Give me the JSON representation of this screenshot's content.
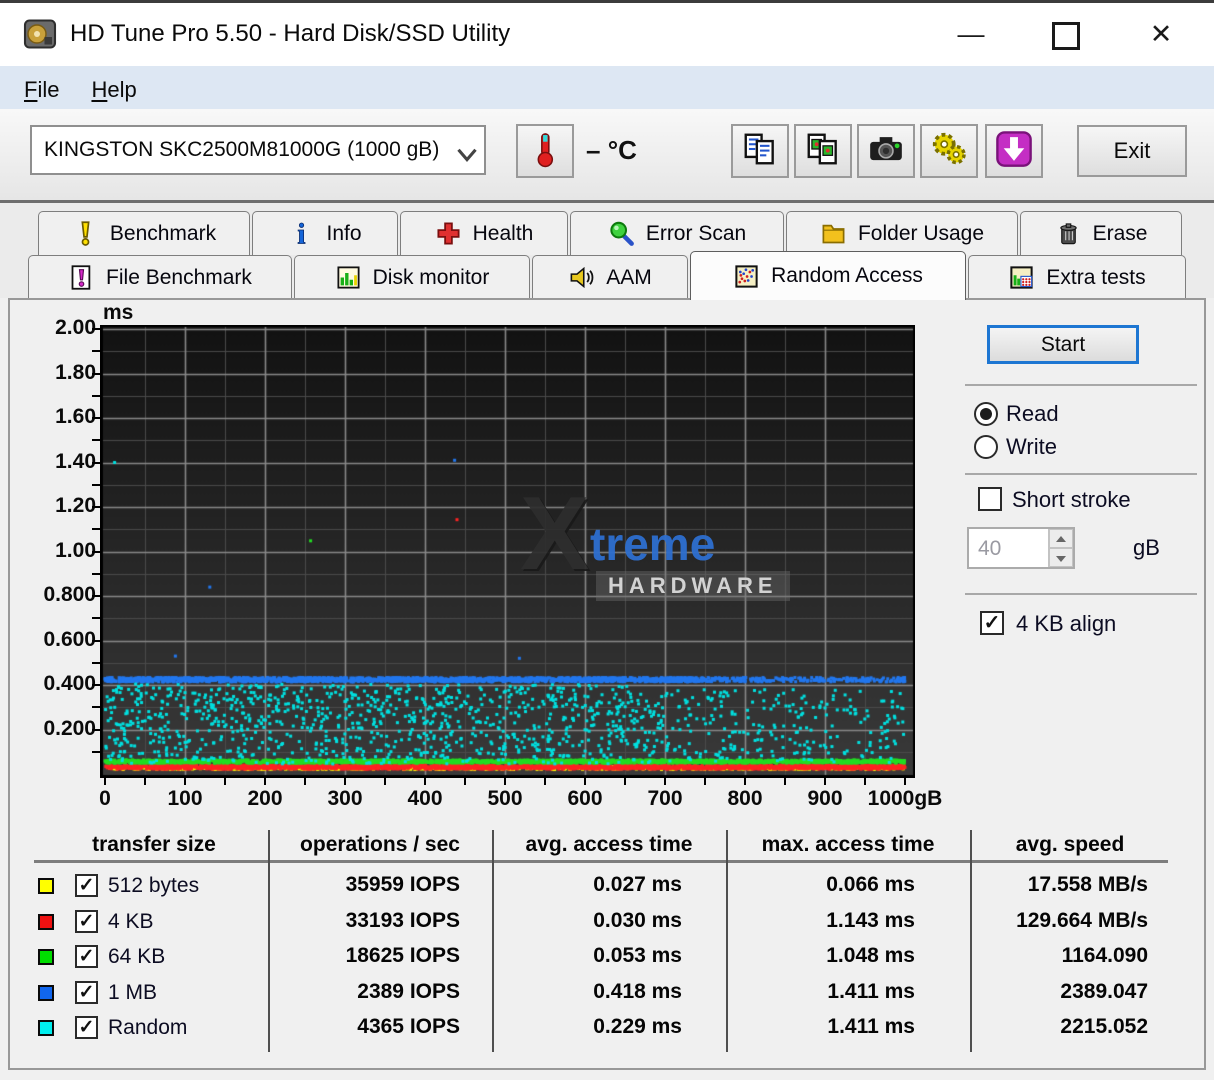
{
  "window": {
    "title": "HD Tune Pro 5.50 - Hard Disk/SSD Utility"
  },
  "menu": {
    "items": [
      {
        "label": "File"
      },
      {
        "label": "Help"
      }
    ]
  },
  "toolbar": {
    "device_select": {
      "value": "KINGSTON SKC2500M81000G (1000 gB)"
    },
    "temperature": {
      "value": "–",
      "unit": "°C"
    },
    "buttons": [
      {
        "name": "copy-text-button",
        "icon": "copy-text-icon"
      },
      {
        "name": "copy-image-button",
        "icon": "copy-image-icon"
      },
      {
        "name": "screenshot-button",
        "icon": "camera-icon"
      },
      {
        "name": "options-button",
        "icon": "gears-icon"
      },
      {
        "name": "update-button",
        "icon": "download-icon"
      }
    ],
    "exit_label": "Exit"
  },
  "tabs": {
    "row1": [
      {
        "label": "Benchmark",
        "icon": "benchmark-icon"
      },
      {
        "label": "Info",
        "icon": "info-icon"
      },
      {
        "label": "Health",
        "icon": "health-icon"
      },
      {
        "label": "Error Scan",
        "icon": "error-scan-icon"
      },
      {
        "label": "Folder Usage",
        "icon": "folder-icon"
      },
      {
        "label": "Erase",
        "icon": "erase-icon"
      }
    ],
    "row2": [
      {
        "label": "File Benchmark",
        "icon": "file-benchmark-icon"
      },
      {
        "label": "Disk monitor",
        "icon": "disk-monitor-icon"
      },
      {
        "label": "AAM",
        "icon": "aam-icon"
      },
      {
        "label": "Random Access",
        "icon": "random-access-icon",
        "active": true
      },
      {
        "label": "Extra tests",
        "icon": "extra-tests-icon"
      }
    ]
  },
  "controls": {
    "start_label": "Start",
    "read_label": "Read",
    "write_label": "Write",
    "read_selected": true,
    "short_stroke_label": "Short stroke",
    "short_stroke_checked": false,
    "short_stroke_value": "40",
    "short_stroke_unit": "gB",
    "align_label": "4 KB align",
    "align_checked": true
  },
  "chart_data": {
    "type": "scatter",
    "y_axis_label": "ms",
    "x_axis_unit": "gB",
    "xlim": [
      0,
      1000
    ],
    "ylim": [
      0,
      2
    ],
    "grid": true,
    "background": "#1a1a1a",
    "x_ticks": {
      "values": [
        0,
        100,
        200,
        300,
        400,
        500,
        600,
        700,
        800,
        900,
        1000
      ],
      "labels": [
        "0",
        "100",
        "200",
        "300",
        "400",
        "500",
        "600",
        "700",
        "800",
        "900",
        "1000gB"
      ],
      "minor_step": 50
    },
    "y_ticks": {
      "values": [
        2.0,
        1.8,
        1.6,
        1.4,
        1.2,
        1.0,
        0.8,
        0.6,
        0.4,
        0.2
      ],
      "labels": [
        "2.00",
        "1.80",
        "1.60",
        "1.40",
        "1.20",
        "1.00",
        "0.800",
        "0.600",
        "0.400",
        "0.200"
      ],
      "minor_step": 0.1
    },
    "series": [
      {
        "name": "512 bytes",
        "color": "#ffff00",
        "point_size": 3,
        "bands": [
          {
            "x_range": [
              0,
              1000
            ],
            "count": 850,
            "y_center": 0.027,
            "y_spread": 0.007
          }
        ]
      },
      {
        "name": "4 KB",
        "color": "#ff2222",
        "point_size": 3,
        "bands": [
          {
            "x_range": [
              0,
              1000
            ],
            "count": 2600,
            "y_center": 0.031,
            "y_spread": 0.009
          }
        ]
      },
      {
        "name": "64 KB",
        "color": "#22dd22",
        "point_size": 3,
        "bands": [
          {
            "x_range": [
              0,
              1000
            ],
            "count": 2400,
            "y_center": 0.056,
            "y_spread": 0.007
          }
        ]
      },
      {
        "name": "1 MB",
        "color": "#2277ee",
        "point_size": 3,
        "bands": [
          {
            "x_range": [
              0,
              755
            ],
            "count": 1700,
            "y_center": 0.424,
            "y_spread": 0.01
          },
          {
            "x_range": [
              755,
              1000
            ],
            "count": 230,
            "y_center": 0.424,
            "y_spread": 0.01
          }
        ]
      },
      {
        "name": "Random",
        "color": "#00e0e0",
        "point_size": 3,
        "bands": [
          {
            "x_range": [
              0,
              700
            ],
            "count": 1050,
            "y_center": 0.225,
            "y_spread": 0.18
          },
          {
            "x_range": [
              700,
              1000
            ],
            "count": 250,
            "y_center": 0.215,
            "y_spread": 0.165
          }
        ]
      }
    ],
    "outliers": [
      {
        "series": "Random",
        "color": "#00e0e0",
        "x": 12,
        "y": 1.4
      },
      {
        "series": "1 MB",
        "color": "#2277ee",
        "x": 88,
        "y": 0.53
      },
      {
        "series": "1 MB",
        "color": "#2277ee",
        "x": 131,
        "y": 0.84
      },
      {
        "series": "1 MB",
        "color": "#2277ee",
        "x": 437,
        "y": 1.41
      },
      {
        "series": "1 MB",
        "color": "#2277ee",
        "x": 518,
        "y": 0.52
      },
      {
        "series": "4 KB",
        "color": "#ff2222",
        "x": 440,
        "y": 1.143
      },
      {
        "series": "64 KB",
        "color": "#22dd22",
        "x": 257,
        "y": 1.048
      }
    ],
    "watermark": {
      "x_part": "X",
      "treme_part": "treme",
      "line2": "HARDWARE"
    }
  },
  "results_table": {
    "columns": [
      "transfer size",
      "operations / sec",
      "avg. access time",
      "max. access time",
      "avg. speed"
    ],
    "rows": [
      {
        "color": "#ffff00",
        "checked": true,
        "label": "512 bytes",
        "ops": "35959 IOPS",
        "avg": "0.027 ms",
        "max": "0.066 ms",
        "speed": "17.558 MB/s"
      },
      {
        "color": "#ee1111",
        "checked": true,
        "label": "4 KB",
        "ops": "33193 IOPS",
        "avg": "0.030 ms",
        "max": "1.143 ms",
        "speed": "129.664 MB/s"
      },
      {
        "color": "#00dd00",
        "checked": true,
        "label": "64 KB",
        "ops": "18625 IOPS",
        "avg": "0.053 ms",
        "max": "1.048 ms",
        "speed": "1164.090"
      },
      {
        "color": "#1166ee",
        "checked": true,
        "label": "1 MB",
        "ops": "2389 IOPS",
        "avg": "0.418 ms",
        "max": "1.411 ms",
        "speed": "2389.047"
      },
      {
        "color": "#00eeee",
        "checked": true,
        "label": "Random",
        "ops": "4365 IOPS",
        "avg": "0.229 ms",
        "max": "1.411 ms",
        "speed": "2215.052"
      }
    ]
  }
}
